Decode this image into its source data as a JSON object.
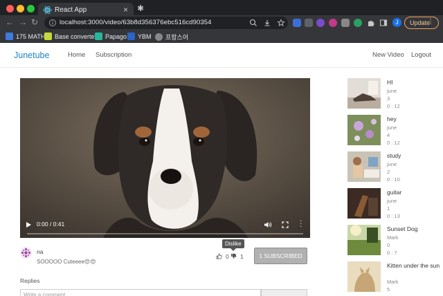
{
  "browser": {
    "tab_title": "React App",
    "tab_close": "×",
    "new_tab": "✱",
    "url": "localhost:3000/video/63b8d356376ebc516cd90354",
    "update_label": "Update",
    "update_menu": "⋮",
    "profile_initial": "J",
    "back": "←",
    "forward": "→",
    "reload": "↻",
    "bookmarks": [
      {
        "label": "175 MATH",
        "color": "#3d7bdc"
      },
      {
        "label": "Base converter",
        "color": "#c6d83a"
      },
      {
        "label": "Papago",
        "color": "#26b79b"
      },
      {
        "label": "YBM",
        "color": "#2b64c6"
      },
      {
        "label": "프랑스어",
        "color": "#888888"
      }
    ]
  },
  "app": {
    "brand": "Junetube",
    "nav": {
      "home": "Home",
      "subscription": "Subscription",
      "new_video": "New Video",
      "logout": "Logout"
    },
    "brand_color": "#1d84c6"
  },
  "player": {
    "time": "0:00 / 0:41",
    "progress_fraction": 0.0
  },
  "comment": {
    "user": "na",
    "text": "SOOOOO Cuteeee😍😍",
    "likes": "0",
    "dislikes": "1",
    "tooltip": "Dislike"
  },
  "subscribe_label": "1 SUBSCRIBED",
  "replies_label": "Replies",
  "reply_placeholder": "Write a comment...",
  "sidebar": [
    {
      "title": "HI",
      "author": "june",
      "views": "3",
      "duration": "0 : 12"
    },
    {
      "title": "hey",
      "author": "june",
      "views": "4",
      "duration": "0 : 12"
    },
    {
      "title": "study",
      "author": "june",
      "views": "2",
      "duration": "0 : 10"
    },
    {
      "title": "guitar",
      "author": "june",
      "views": "1",
      "duration": "0 : 13"
    },
    {
      "title": "Sunset Dog",
      "author": "Mark",
      "views": "0",
      "duration": "0 : 7"
    },
    {
      "title": "Kitten under the sun",
      "author": "Mark",
      "views": "5",
      "duration": ""
    }
  ]
}
